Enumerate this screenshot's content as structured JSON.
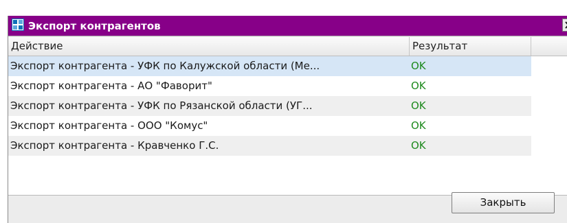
{
  "window": {
    "title": "Экспорт контрагентов",
    "icon": "app-logo-icon",
    "close_icon": "close-icon"
  },
  "table": {
    "columns": [
      "Действие",
      "Результат"
    ],
    "rows": [
      {
        "action": "Экспорт контрагента - УФК по Калужской области (Ме...",
        "result": "OK",
        "selected": true
      },
      {
        "action": "Экспорт контрагента - АО \"Фаворит\"",
        "result": "OK",
        "selected": false
      },
      {
        "action": "Экспорт контрагента - УФК по Рязанской области (УГ...",
        "result": "OK",
        "selected": false
      },
      {
        "action": "Экспорт контрагента - ООО \"Комус\"",
        "result": "OK",
        "selected": false
      },
      {
        "action": "Экспорт контрагента - Кравченко Г.С.",
        "result": "OK",
        "selected": false
      }
    ]
  },
  "footer": {
    "close_label": "Закрыть"
  },
  "colors": {
    "titlebar": "#870088",
    "selected_row": "#d6e6f6",
    "ok_text": "#1e8a1e"
  }
}
